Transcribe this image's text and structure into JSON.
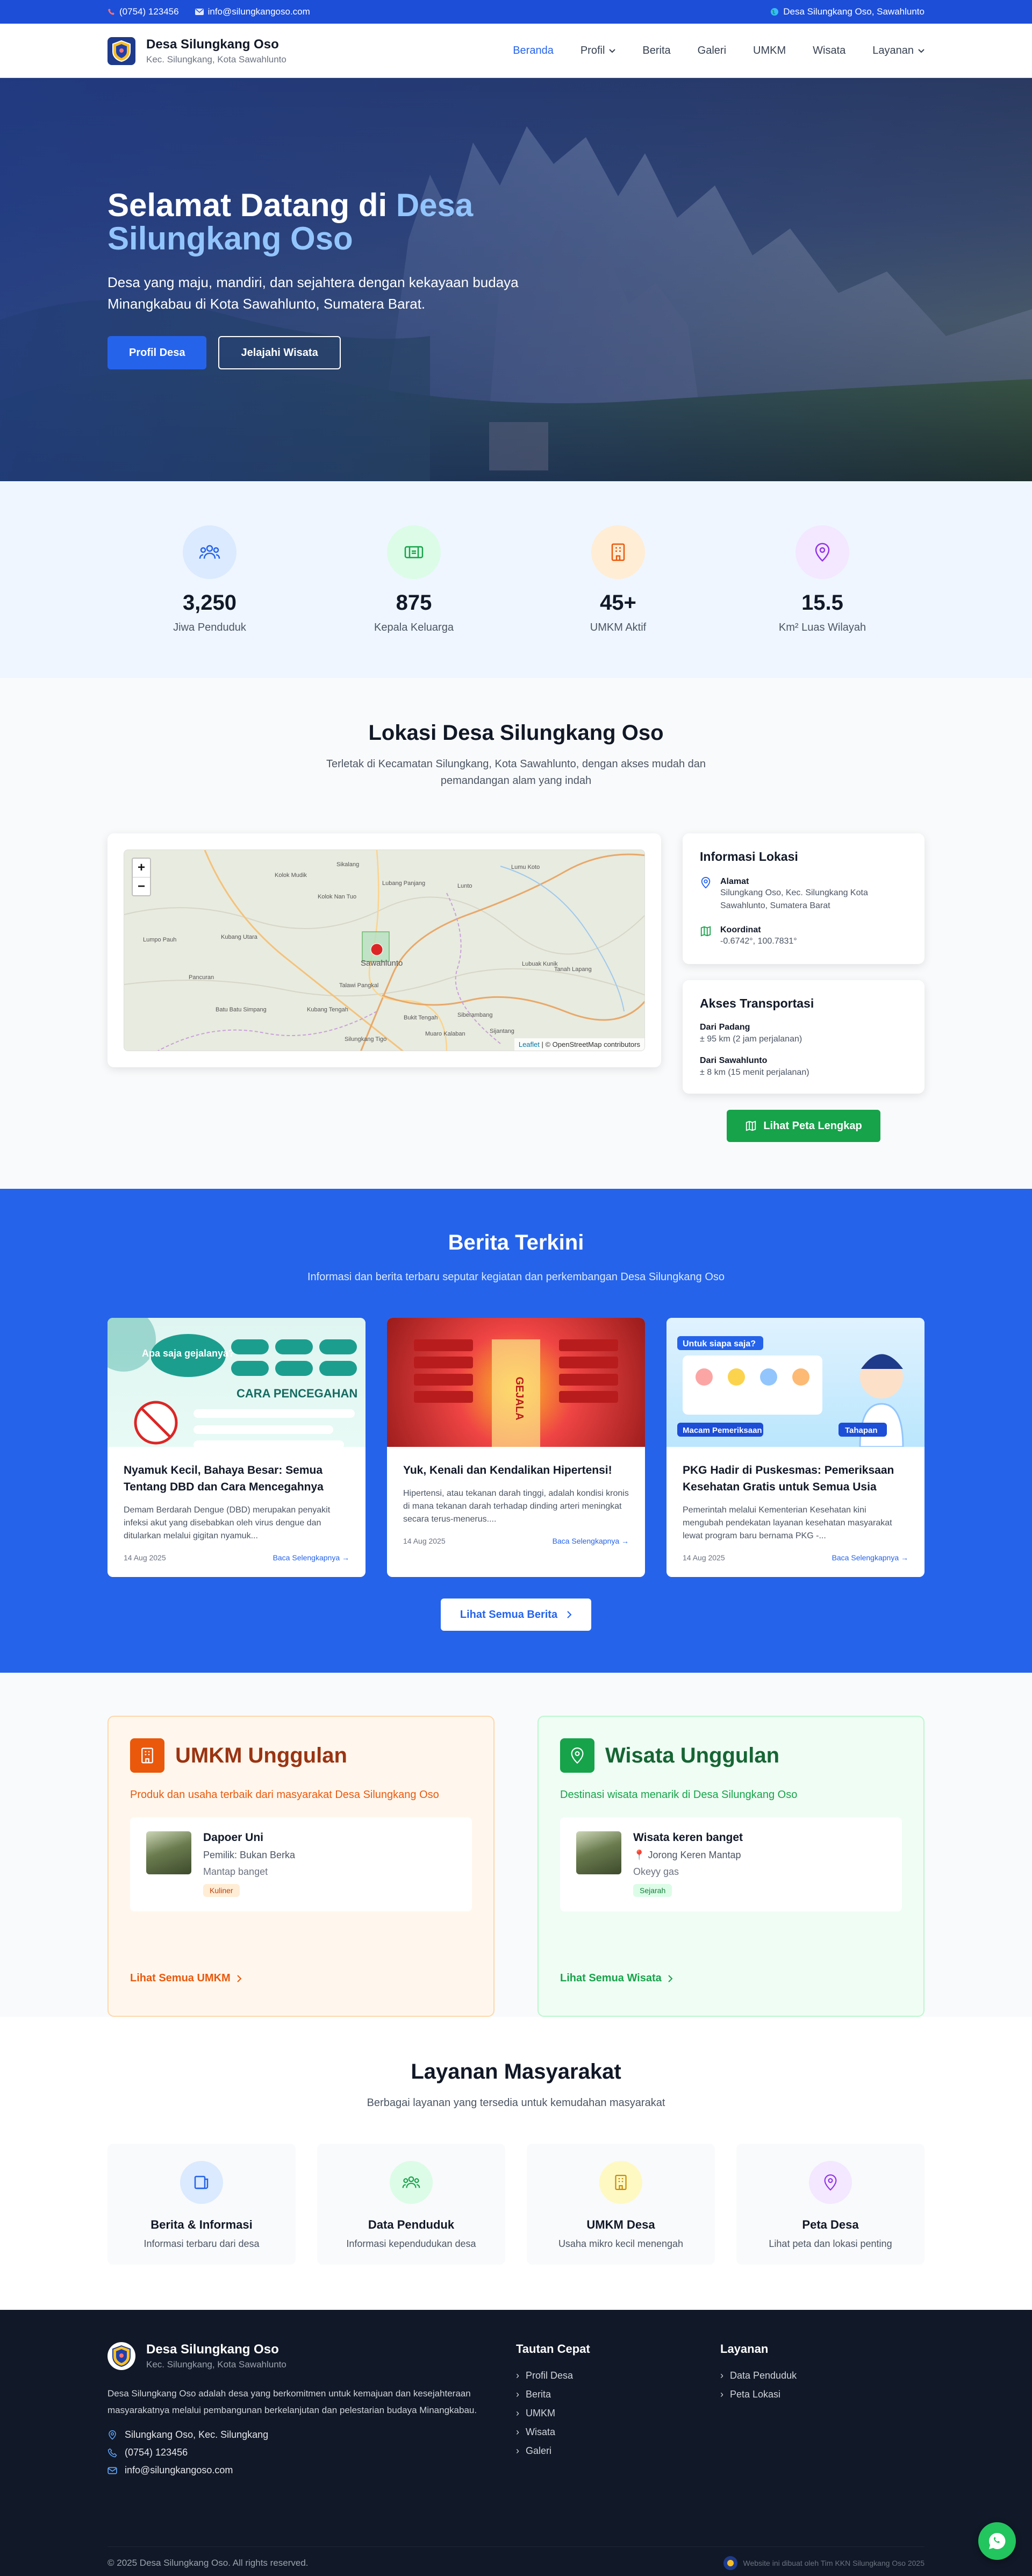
{
  "topbar": {
    "phone": "(0754) 123456",
    "email": "info@silungkangoso.com",
    "location": "Desa Silungkang Oso, Sawahlunto"
  },
  "header": {
    "title": "Desa Silungkang Oso",
    "subtitle": "Kec. Silungkang, Kota Sawahlunto",
    "nav": [
      "Beranda",
      "Profil",
      "Berita",
      "Galeri",
      "UMKM",
      "Wisata",
      "Layanan"
    ]
  },
  "hero": {
    "title_plain": "Selamat Datang di ",
    "title_accent": "Desa Silungkang Oso",
    "description": "Desa yang maju, mandiri, dan sejahtera dengan kekayaan budaya Minangkabau di Kota Sawahlunto, Sumatera Barat.",
    "btn_primary": "Profil Desa",
    "btn_secondary": "Jelajahi Wisata"
  },
  "stats": [
    {
      "value": "3,250",
      "label": "Jiwa Penduduk",
      "icon": "users-icon",
      "color": "#2563eb",
      "bg": "#dbeafe"
    },
    {
      "value": "875",
      "label": "Kepala Keluarga",
      "icon": "id-card-icon",
      "color": "#16a34a",
      "bg": "#dcfce7"
    },
    {
      "value": "45+",
      "label": "UMKM Aktif",
      "icon": "building-icon",
      "color": "#ea580c",
      "bg": "#ffedd5"
    },
    {
      "value": "15.5",
      "label": "Km² Luas Wilayah",
      "icon": "map-pin-icon",
      "color": "#9333ea",
      "bg": "#f3e8ff"
    }
  ],
  "location": {
    "title": "Lokasi Desa Silungkang Oso",
    "subtitle": "Terletak di Kecamatan Silungkang, Kota Sawahlunto, dengan akses mudah dan pemandangan alam yang indah",
    "map": {
      "zoom_in": "+",
      "zoom_out": "−",
      "attribution_link": "Leaflet",
      "attribution_text": " | © OpenStreetMap contributors",
      "places": [
        "Sikalang",
        "Lumu Koto",
        "Kolok Mudik",
        "Lunto",
        "Kolok Nan Tuo",
        "Lubang Panjang",
        "Lumpo Pauh",
        "Kubang Utara",
        "Pancuran",
        "Sawahlunto",
        "Batu Batu Simpang",
        "Talawi Pangkal",
        "Lubuak Kunik",
        "Tanah Lapang",
        "Siberambang",
        "Bukit Tengah",
        "Kubang Tengah",
        "Muaro Kalaban",
        "Silungkang Tigo",
        "Sijantang"
      ]
    },
    "info_title": "Informasi Lokasi",
    "address_label": "Alamat",
    "address_value": "Silungkang Oso, Kec. Silungkang Kota Sawahlunto, Sumatera Barat",
    "coord_label": "Koordinat",
    "coord_value": "-0.6742°, 100.7831°",
    "transport_title": "Akses Transportasi",
    "transport": [
      {
        "from": "Dari Padang",
        "distance": "± 95 km (2 jam perjalanan)"
      },
      {
        "from": "Dari Sawahlunto",
        "distance": "± 8 km (15 menit perjalanan)"
      }
    ],
    "map_button": "Lihat Peta Lengkap"
  },
  "news": {
    "title": "Berita Terkini",
    "subtitle": "Informasi dan berita terbaru seputar kegiatan dan perkembangan Desa Silungkang Oso",
    "items": [
      {
        "title": "Nyamuk Kecil, Bahaya Besar: Semua Tentang DBD dan Cara Mencegahnya",
        "excerpt": "Demam Berdarah Dengue (DBD) merupakan penyakit infeksi akut yang disebabkan oleh virus dengue dan ditularkan melalui gigitan nyamuk...",
        "date": "14 Aug 2025",
        "more": "Baca Selengkapnya →",
        "img_caption": "CARA PENCEGAHAN",
        "img_q": "Apa saja gejalanya?"
      },
      {
        "title": "Yuk, Kenali dan Kendalikan Hipertensi!",
        "excerpt": "Hipertensi, atau tekanan darah tinggi, adalah kondisi kronis di mana tekanan darah terhadap dinding arteri meningkat secara terus-menerus....",
        "date": "14 Aug 2025",
        "more": "Baca Selengkapnya →",
        "img_caption": "GEJALA"
      },
      {
        "title": "PKG Hadir di Puskesmas: Pemeriksaan Kesehatan Gratis untuk Semua Usia",
        "excerpt": "Pemerintah melalui Kementerian Kesehatan kini mengubah pendekatan layanan kesehatan masyarakat lewat program baru bernama PKG -...",
        "date": "14 Aug 2025",
        "more": "Baca Selengkapnya →",
        "img_caption": "Untuk siapa saja?",
        "img_tag1": "Macam Pemeriksaan",
        "img_tag2": "Tahapan"
      }
    ],
    "all_button": "Lihat Semua Berita"
  },
  "umkm": {
    "title": "UMKM Unggulan",
    "subtitle": "Produk dan usaha terbaik dari masyarakat Desa Silungkang Oso",
    "item_name": "Dapoer Uni",
    "item_owner": "Pemilik: Bukan Berka",
    "item_desc": "Mantap banget",
    "item_tag": "Kuliner",
    "link": "Lihat Semua UMKM"
  },
  "wisata": {
    "title": "Wisata Unggulan",
    "subtitle": "Destinasi wisata menarik di Desa Silungkang Oso",
    "item_name": "Wisata keren banget",
    "item_place": "Jorong Keren Mantap",
    "item_desc": "Okeyy gas",
    "item_tag": "Sejarah",
    "link": "Lihat Semua Wisata"
  },
  "services": {
    "title": "Layanan Masyarakat",
    "subtitle": "Berbagai layanan yang tersedia untuk kemudahan masyarakat",
    "items": [
      {
        "title": "Berita & Informasi",
        "desc": "Informasi terbaru dari desa",
        "icon": "news-icon",
        "color": "#2563eb",
        "bg": "#dbeafe"
      },
      {
        "title": "Data Penduduk",
        "desc": "Informasi kependudukan desa",
        "icon": "users-icon",
        "color": "#16a34a",
        "bg": "#dcfce7"
      },
      {
        "title": "UMKM Desa",
        "desc": "Usaha mikro kecil menengah",
        "icon": "building-icon",
        "color": "#ca8a04",
        "bg": "#fef9c3"
      },
      {
        "title": "Peta Desa",
        "desc": "Lihat peta dan lokasi penting",
        "icon": "map-pin-icon",
        "color": "#9333ea",
        "bg": "#f3e8ff"
      }
    ]
  },
  "footer": {
    "title": "Desa Silungkang Oso",
    "subtitle": "Kec. Silungkang, Kota Sawahlunto",
    "description": "Desa Silungkang Oso adalah desa yang berkomitmen untuk kemajuan dan kesejahteraan masyarakatnya melalui pembangunan berkelanjutan dan pelestarian budaya Minangkabau.",
    "address": "Silungkang Oso, Kec. Silungkang",
    "phone": "(0754) 123456",
    "email": "info@silungkangoso.com",
    "quick_title": "Tautan Cepat",
    "quick_links": [
      "Profil Desa",
      "Berita",
      "UMKM",
      "Wisata",
      "Galeri"
    ],
    "service_title": "Layanan",
    "service_links": [
      "Data Penduduk",
      "Peta Lokasi"
    ],
    "copyright": "© 2025 Desa Silungkang Oso. All rights reserved.",
    "credit": "Website ini dibuat oleh Tim KKN Silungkang Oso 2025"
  }
}
